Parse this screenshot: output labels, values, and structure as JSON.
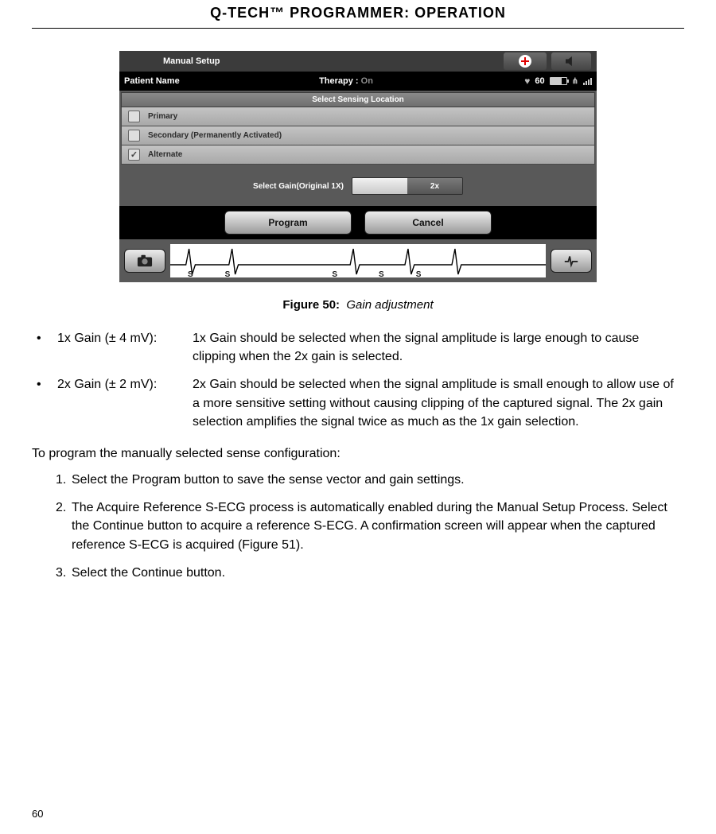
{
  "page_title": "Q-TECH™ PROGRAMMER:  OPERATION",
  "device": {
    "header_title": "Manual Setup",
    "status": {
      "patient_label": "Patient Name",
      "therapy_label": "Therapy :",
      "therapy_value": "On",
      "heart_rate": "60"
    },
    "sensing": {
      "title": "Select Sensing Location",
      "primary": "Primary",
      "secondary": "Secondary (Permanently Activated)",
      "alternate": "Alternate"
    },
    "gain": {
      "label": "Select Gain(Original 1X)",
      "value": "2x"
    },
    "buttons": {
      "program": "Program",
      "cancel": "Cancel"
    },
    "ecg_markers": [
      "S",
      "S",
      "S",
      "S",
      "S"
    ]
  },
  "caption": {
    "prefix": "Figure 50:",
    "text": "Gain adjustment"
  },
  "bullets": [
    {
      "term": "1x Gain (± 4 mV):",
      "desc": "1x Gain should be selected when the signal amplitude is large enough to cause clipping when the 2x gain is selected."
    },
    {
      "term": "2x Gain (± 2 mV):",
      "desc": "2x Gain should be selected when the signal amplitude is small enough to allow use of a more sensitive setting without causing clipping of the captured signal. The 2x gain selection amplifies the signal twice as much as the 1x gain selection."
    }
  ],
  "prog_intro": "To program the manually selected sense configuration:",
  "steps": [
    {
      "n": "1.",
      "t": "Select the Program button to save the sense vector and gain settings."
    },
    {
      "n": "2.",
      "t": "The Acquire Reference S-ECG process is automatically enabled during the Manual Setup Process. Select the Continue button to acquire a reference S-ECG. A confirmation screen will appear when the captured reference S-ECG is acquired (Figure 51)."
    },
    {
      "n": "3.",
      "t": "Select the Continue button."
    }
  ],
  "page_number": "60"
}
